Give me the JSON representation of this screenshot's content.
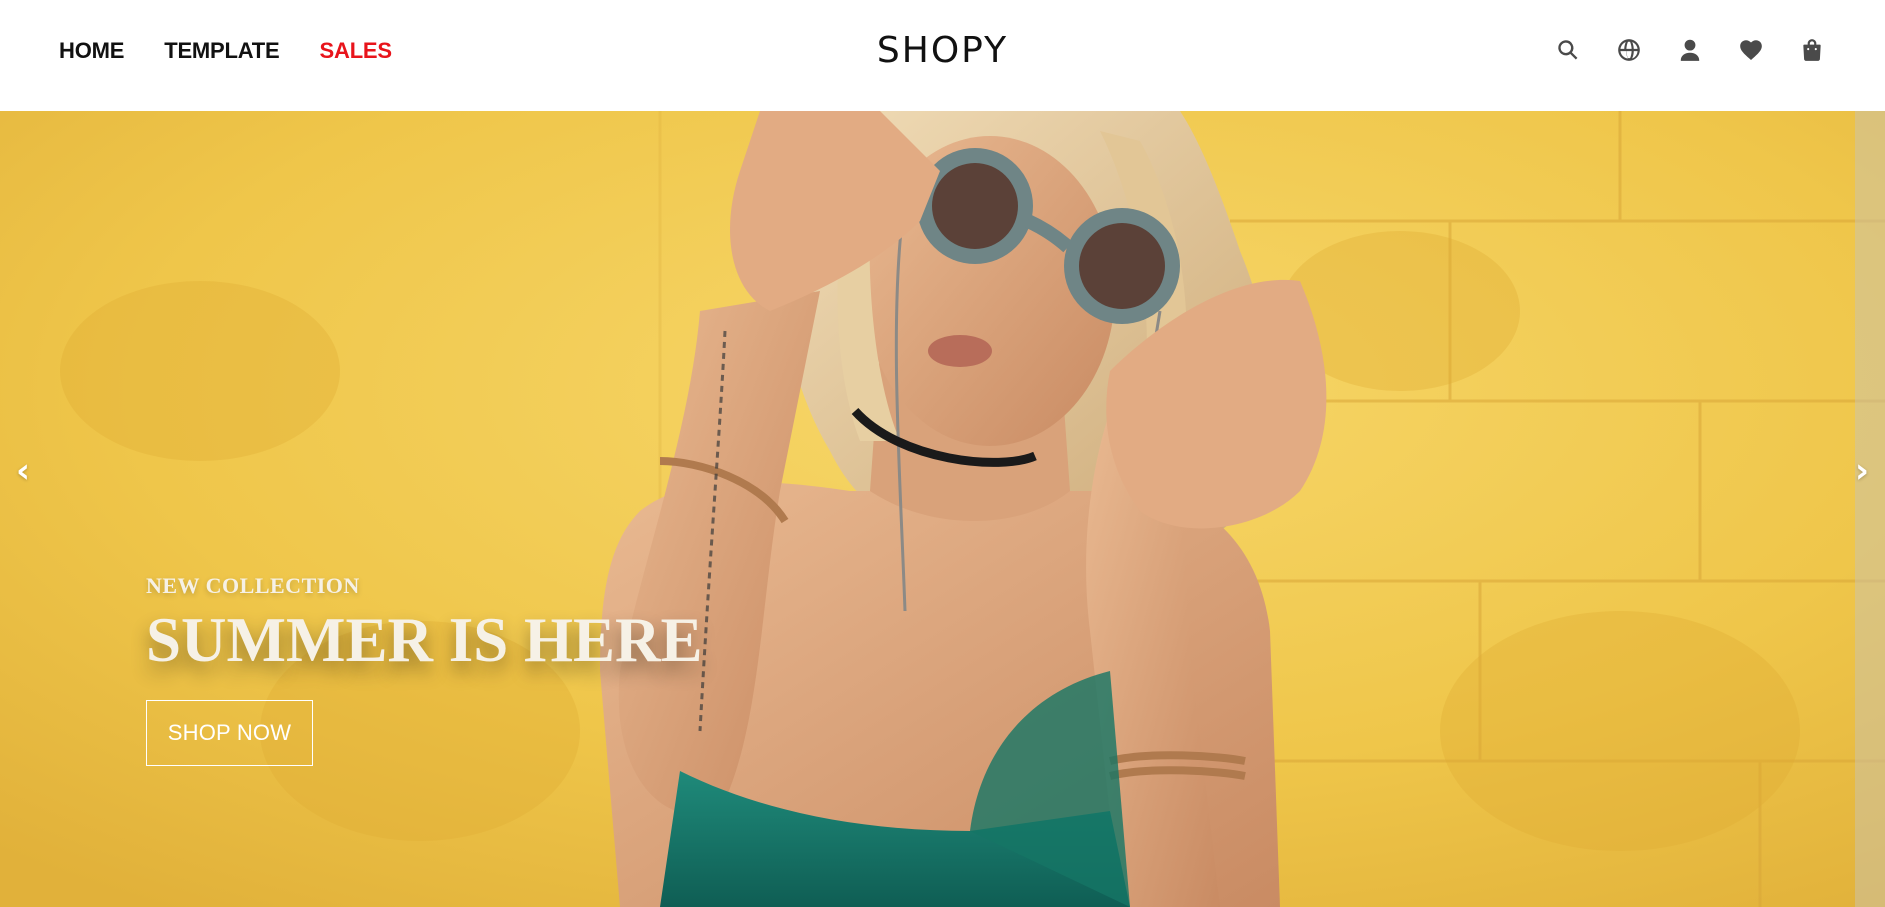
{
  "header": {
    "nav": [
      {
        "label": "HOME"
      },
      {
        "label": "TEMPLATE"
      },
      {
        "label": "SALES"
      }
    ],
    "logo": "SHOPY",
    "icons": [
      "search-icon",
      "globe-icon",
      "user-icon",
      "heart-icon",
      "bag-icon"
    ]
  },
  "hero": {
    "eyebrow": "NEW COLLECTION",
    "headline": "SUMMER IS HERE",
    "cta_label": "SHOP NOW",
    "prev_arrow": "‹",
    "next_arrow": "›"
  },
  "colors": {
    "accent_sales": "#e8141b",
    "background_yellow": "#efc64a",
    "nav_text": "#111111",
    "icon": "#4a4a4a"
  }
}
